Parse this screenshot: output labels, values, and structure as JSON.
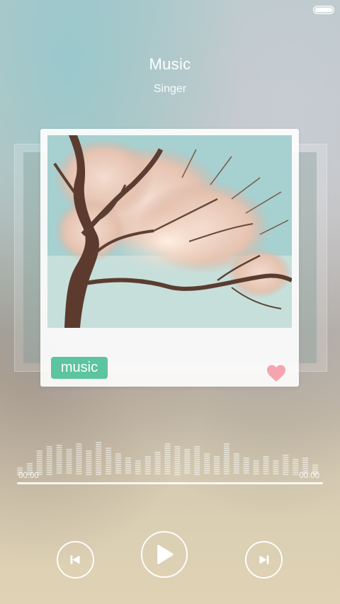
{
  "track": {
    "title": "Music",
    "artist": "Singer",
    "tag": "music"
  },
  "player": {
    "elapsed": "00:00",
    "duration": "00:00"
  },
  "controls": {
    "prev_icon": "previous-track-icon",
    "play_icon": "play-icon",
    "next_icon": "next-track-icon"
  },
  "colors": {
    "tag": "#5cc4a0",
    "heart": "#f4a5ad"
  }
}
